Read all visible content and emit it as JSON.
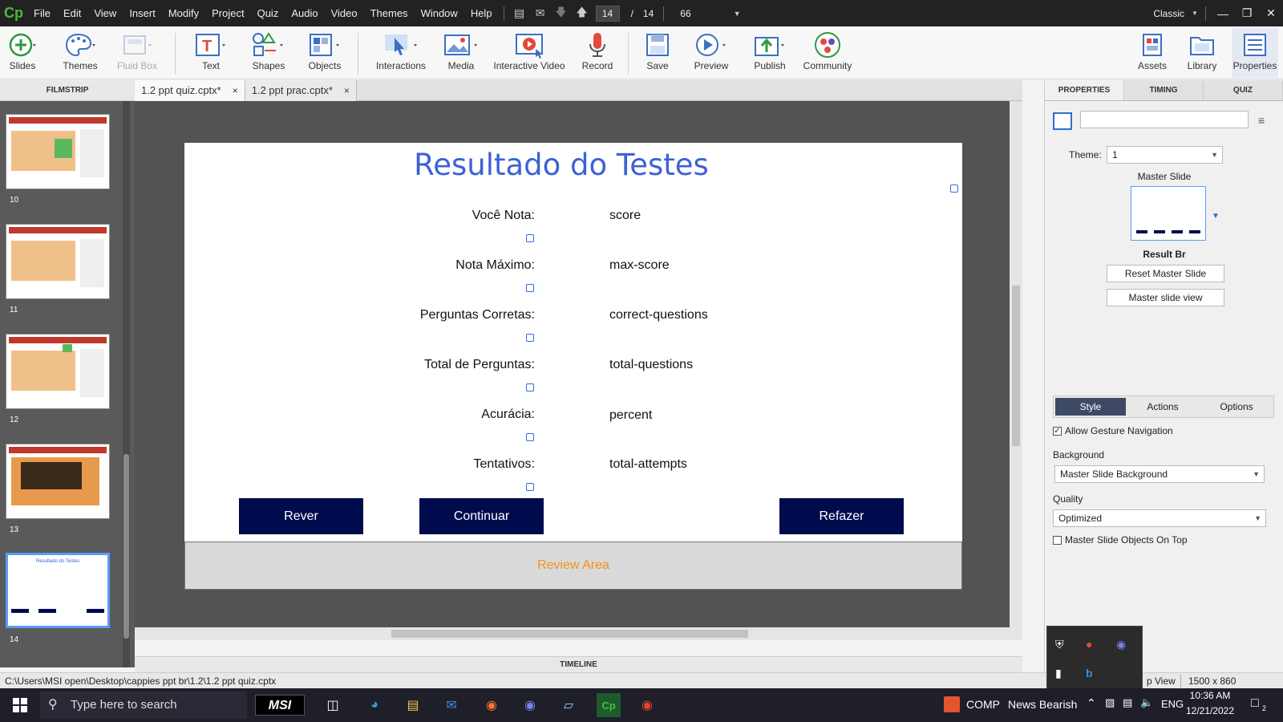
{
  "app": {
    "logo": "Cp",
    "menu": [
      "File",
      "Edit",
      "View",
      "Insert",
      "Modify",
      "Project",
      "Quiz",
      "Audio",
      "Video",
      "Themes",
      "Window",
      "Help"
    ],
    "current_slide": "14",
    "slide_sep": "/",
    "total_slides": "14",
    "zoom": "66",
    "workspace": "Classic"
  },
  "toolbar": {
    "slides": "Slides",
    "themes": "Themes",
    "fluid_box": "Fluid Box",
    "text": "Text",
    "shapes": "Shapes",
    "objects": "Objects",
    "interactions": "Interactions",
    "media": "Media",
    "interactive_video": "Interactive Video",
    "record": "Record",
    "save": "Save",
    "preview": "Preview",
    "publish": "Publish",
    "community": "Community",
    "assets": "Assets",
    "library": "Library",
    "properties": "Properties"
  },
  "filmstrip": {
    "header": "FILMSTRIP",
    "numbers": [
      "10",
      "11",
      "12",
      "13",
      "14"
    ],
    "mini_title": "Resultado do Testes"
  },
  "tabs": [
    {
      "label": "1.2 ppt quiz.cptx*",
      "close": "×"
    },
    {
      "label": "1.2 ppt prac.cptx*",
      "close": "×"
    }
  ],
  "slide": {
    "title": "Resultado do Testes",
    "rows": [
      {
        "label": "Você Nota:",
        "value": "score"
      },
      {
        "label": "Nota Máximo:",
        "value": "max-score"
      },
      {
        "label": "Perguntas Corretas:",
        "value": "correct-questions"
      },
      {
        "label": "Total de Perguntas:",
        "value": "total-questions"
      },
      {
        "label": "Acurácia:",
        "value": "percent"
      },
      {
        "label": "Tentativos:",
        "value": "total-attempts"
      }
    ],
    "buttons": {
      "review": "Rever",
      "continue": "Continuar",
      "retake": "Refazer"
    },
    "review_area": "Review Area"
  },
  "timeline": "TIMELINE",
  "properties": {
    "tabs": [
      "PROPERTIES",
      "TIMING",
      "QUIZ"
    ],
    "name_value": "",
    "theme_label": "Theme:",
    "theme_value": "1",
    "master_slide_label": "Master Slide",
    "master_slide_name": "Result Br",
    "reset_master": "Reset Master Slide",
    "master_view": "Master slide view",
    "subtabs": [
      "Style",
      "Actions",
      "Options"
    ],
    "allow_gesture": "Allow Gesture Navigation",
    "allow_gesture_checked": true,
    "background_label": "Background",
    "background_value": "Master Slide Background",
    "quality_label": "Quality",
    "quality_value": "Optimized",
    "master_on_top": "Master Slide Objects On Top",
    "master_on_top_checked": false
  },
  "status": {
    "path": "C:\\Users\\MSI open\\Desktop\\cappies ppt br\\1.2\\1.2 ppt quiz.cptx",
    "view": "p View",
    "size": "1500 x 860"
  },
  "taskbar": {
    "search_placeholder": "Type here to search",
    "msi": "MSI",
    "tray_comp": "COMP",
    "news": "News Bearish",
    "lang": "ENG",
    "time": "10:36 AM",
    "date": "12/21/2022",
    "notif_count": "2"
  },
  "colors": {
    "slide_title": "#3c62d6",
    "button_bg": "#000b4d",
    "review_text": "#f39019",
    "accent_blue": "#5b9bf8"
  }
}
